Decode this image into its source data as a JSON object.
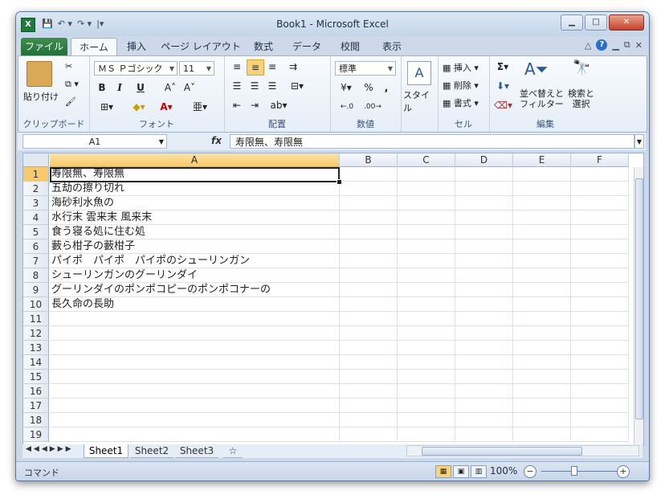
{
  "window": {
    "title": "Book1 - Microsoft Excel"
  },
  "qat": {
    "save": "💾",
    "undo": "↶ ▾",
    "redo": "↷ ▾",
    "customize": "|▾"
  },
  "tabs": [
    "ファイル",
    "ホーム",
    "挿入",
    "ページ レイアウト",
    "数式",
    "データ",
    "校閲",
    "表示"
  ],
  "ribbon": {
    "clipboard": {
      "label": "クリップボード",
      "paste": "貼り付け"
    },
    "font": {
      "label": "フォント",
      "name": "ＭＳ Ｐゴシック",
      "size": "11",
      "bold": "B",
      "italic": "I",
      "underline": "U",
      "grow": "A˄",
      "shrink": "A˅"
    },
    "alignment": {
      "label": "配置"
    },
    "number": {
      "label": "数値",
      "format": "標準",
      "percent": "%",
      "comma": ","
    },
    "styles": {
      "label": "スタイル"
    },
    "cells": {
      "label": "セル",
      "insert": "挿入",
      "delete": "削除",
      "format": "書式"
    },
    "editing": {
      "label": "編集",
      "sort": "並べ替えと\nフィルター",
      "find": "検索と\n選択"
    }
  },
  "formula_bar": {
    "name_box": "A1",
    "fx": "fx",
    "value": "寿限無、寿限無"
  },
  "columns": [
    "A",
    "B",
    "C",
    "D",
    "E",
    "F"
  ],
  "rows": [
    "1",
    "2",
    "3",
    "4",
    "5",
    "6",
    "7",
    "8",
    "9",
    "10",
    "11",
    "12",
    "13",
    "14",
    "15",
    "16",
    "17",
    "18",
    "19"
  ],
  "cells_A": [
    "寿限無、寿限無",
    "五劫の擦り切れ",
    "海砂利水魚の",
    "水行末 雲来末 風来末",
    "食う寝る処に住む処",
    "藪ら柑子の藪柑子",
    "パイポ　パイポ　パイポのシューリンガン",
    "シューリンガンのグーリンダイ",
    "グーリンダイのポンポコピーのポンポコナーの",
    "長久命の長助"
  ],
  "sheet_tabs": [
    "Sheet1",
    "Sheet2",
    "Sheet3"
  ],
  "status": {
    "mode": "コマンド",
    "zoom": "100%"
  }
}
